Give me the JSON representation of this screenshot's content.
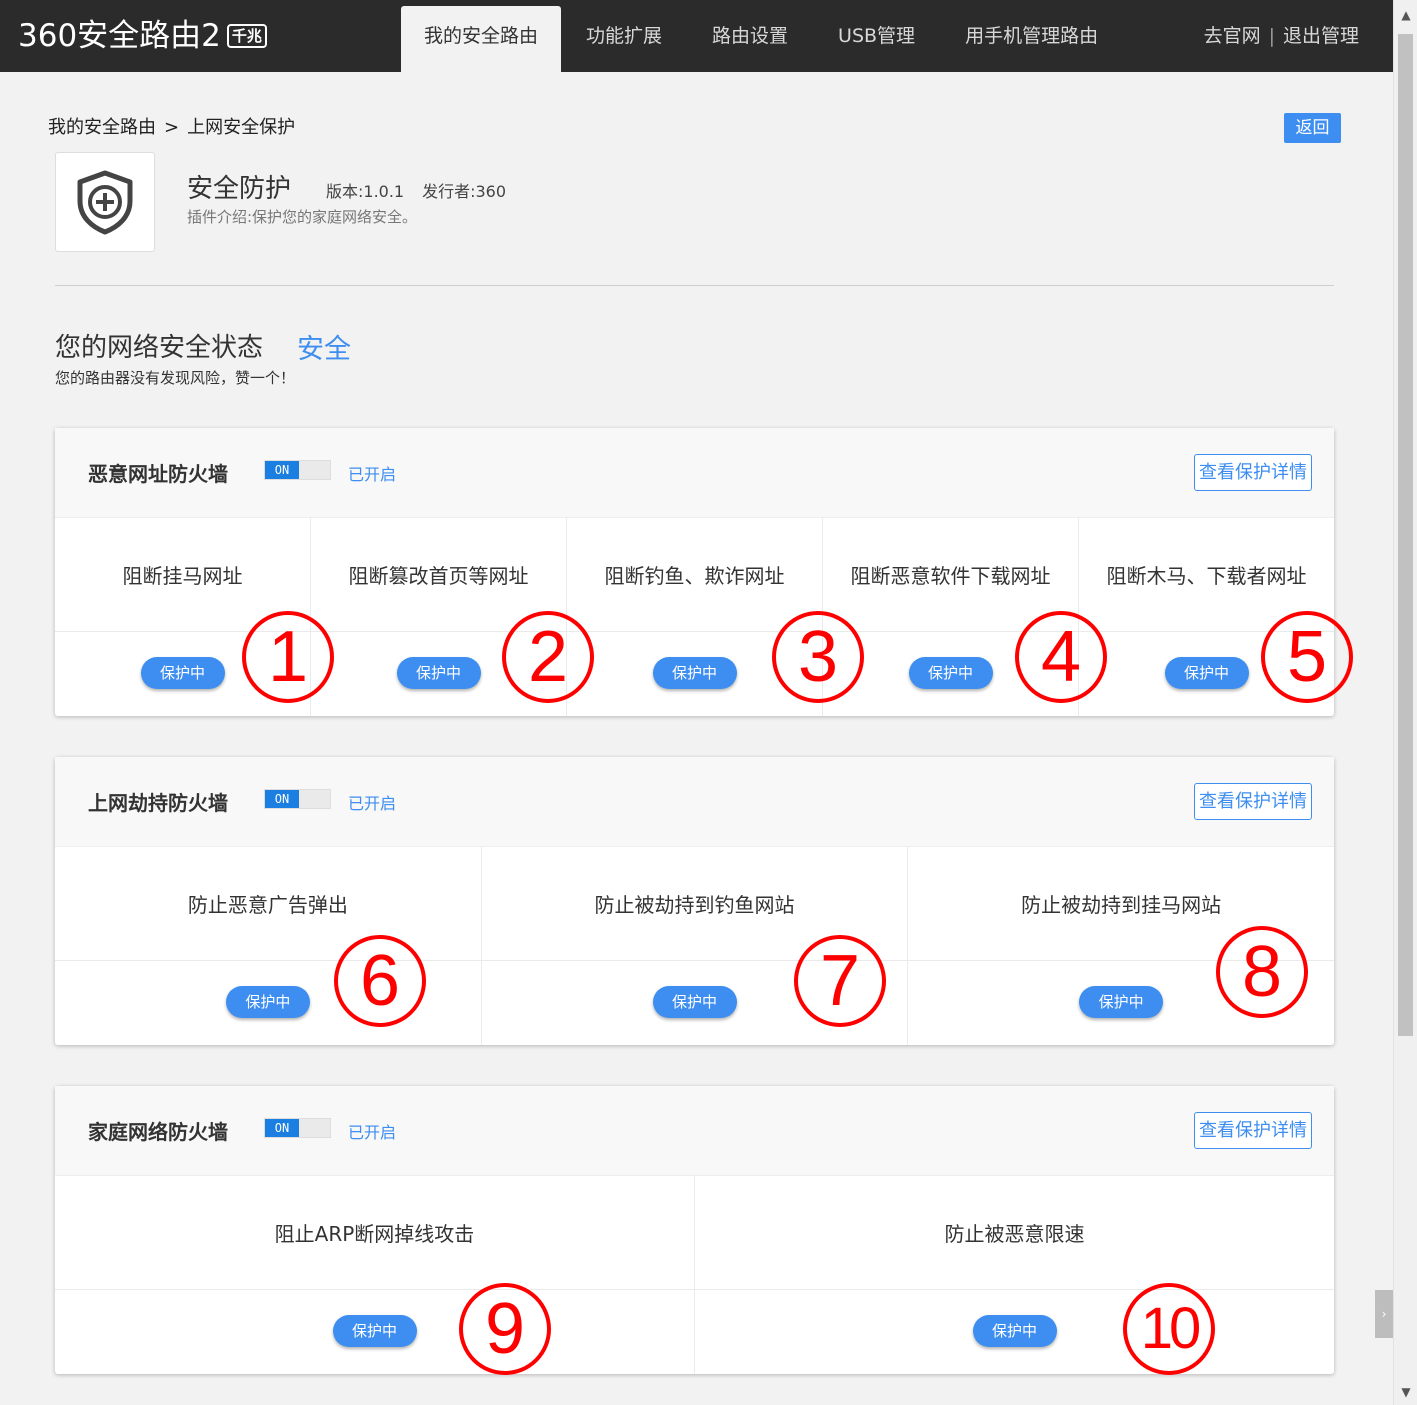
{
  "logo": {
    "main": "360安全路由2",
    "badge": "千兆"
  },
  "nav": [
    {
      "label": "我的安全路由",
      "active": true
    },
    {
      "label": "功能扩展"
    },
    {
      "label": "路由设置"
    },
    {
      "label": "USB管理"
    },
    {
      "label": "用手机管理路由"
    }
  ],
  "top_links": {
    "official": "去官网",
    "sep": "|",
    "logout": "退出管理"
  },
  "breadcrumb": {
    "root": "我的安全路由",
    "arrow": ">",
    "current": "上网安全保护"
  },
  "back_label": "返回",
  "plugin": {
    "icon": "shield-plus-icon",
    "title": "安全防护",
    "version": "版本:1.0.1",
    "publisher": "发行者:360",
    "desc": "插件介绍:保护您的家庭网络安全。"
  },
  "status": {
    "title": "您的网络安全状态",
    "value": "安全",
    "sub": "您的路由器没有发现风险，赞一个！"
  },
  "panels": [
    {
      "title": "恶意网址防火墙",
      "toggle": "ON",
      "state": "已开启",
      "detail": "查看保护详情",
      "items": [
        {
          "label": "阻断挂马网址",
          "status": "保护中",
          "mark": "1"
        },
        {
          "label": "阻断篡改首页等网址",
          "status": "保护中",
          "mark": "2"
        },
        {
          "label": "阻断钓鱼、欺诈网址",
          "status": "保护中",
          "mark": "3"
        },
        {
          "label": "阻断恶意软件下载网址",
          "status": "保护中",
          "mark": "4"
        },
        {
          "label": "阻断木马、下载者网址",
          "status": "保护中",
          "mark": "5"
        }
      ]
    },
    {
      "title": "上网劫持防火墙",
      "toggle": "ON",
      "state": "已开启",
      "detail": "查看保护详情",
      "items": [
        {
          "label": "防止恶意广告弹出",
          "status": "保护中",
          "mark": "6"
        },
        {
          "label": "防止被劫持到钓鱼网站",
          "status": "保护中",
          "mark": "7"
        },
        {
          "label": "防止被劫持到挂马网站",
          "status": "保护中",
          "mark": "8"
        }
      ]
    },
    {
      "title": "家庭网络防火墙",
      "toggle": "ON",
      "state": "已开启",
      "detail": "查看保护详情",
      "items": [
        {
          "label": "阻止ARP断网掉线攻击",
          "status": "保护中",
          "mark": "9"
        },
        {
          "label": "防止被恶意限速",
          "status": "保护中",
          "mark": "10"
        }
      ]
    }
  ],
  "colors": {
    "accent": "#3d8ef0",
    "topbar": "#2b2b2b",
    "annotation": "#ff0000"
  }
}
